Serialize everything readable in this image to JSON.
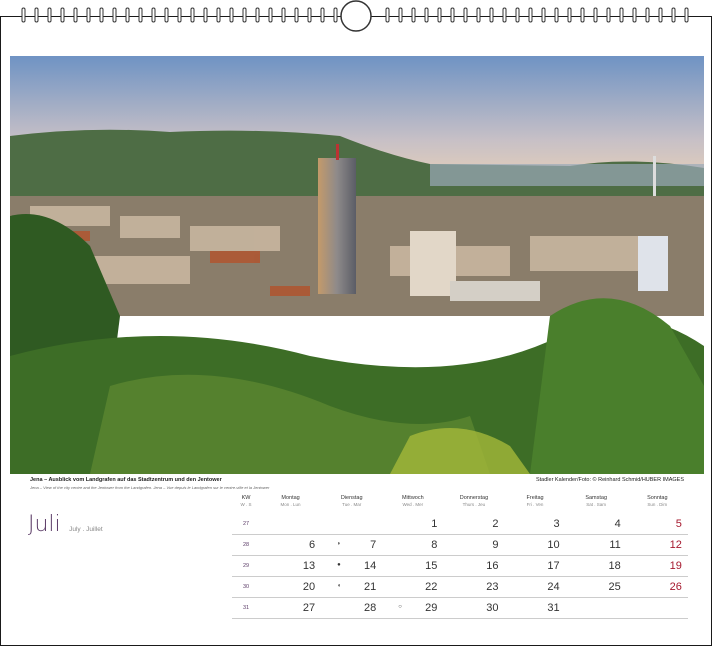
{
  "photo": {
    "caption": "Jena – Ausblick vom Landgrafen auf das Stadtzentrum und den Jentower",
    "caption_en": "Jena – View of the city centre and the Jentower from the Landgrafen. Jena – Vue depuis le Landgrafen sur le centre-ville et la Jentower",
    "credit": "Stadler Kalender/Foto: © Reinhard Schmid/HUBER IMAGES"
  },
  "month": {
    "name": "Juli",
    "sub": "July . Juillet"
  },
  "calendar": {
    "kw_header": {
      "t1": "KW",
      "t2": "W . S"
    },
    "weekdays": [
      {
        "t1": "Montag",
        "t2": "Mon . Lun"
      },
      {
        "t1": "Dienstag",
        "t2": "Tue . Mar"
      },
      {
        "t1": "Mittwoch",
        "t2": "Wed . Mer"
      },
      {
        "t1": "Donnerstag",
        "t2": "Thurs . Jeu"
      },
      {
        "t1": "Freitag",
        "t2": "Fri . Ven"
      },
      {
        "t1": "Samstag",
        "t2": "Sat . Sam"
      },
      {
        "t1": "Sonntag",
        "t2": "Sun . Dim"
      }
    ],
    "weeks": [
      {
        "kw": "27",
        "days": [
          "",
          "",
          "1",
          "2",
          "3",
          "4",
          "5"
        ],
        "moons": [
          "",
          "",
          "",
          "",
          "",
          "",
          ""
        ]
      },
      {
        "kw": "28",
        "days": [
          "6",
          "7",
          "8",
          "9",
          "10",
          "11",
          "12"
        ],
        "moons": [
          "",
          "◗",
          "",
          "",
          "",
          "",
          ""
        ]
      },
      {
        "kw": "29",
        "days": [
          "13",
          "14",
          "15",
          "16",
          "17",
          "18",
          "19"
        ],
        "moons": [
          "",
          "●",
          "",
          "",
          "",
          "",
          ""
        ]
      },
      {
        "kw": "30",
        "days": [
          "20",
          "21",
          "22",
          "23",
          "24",
          "25",
          "26"
        ],
        "moons": [
          "",
          "◖",
          "",
          "",
          "",
          "",
          ""
        ]
      },
      {
        "kw": "31",
        "days": [
          "27",
          "28",
          "29",
          "30",
          "31",
          "",
          ""
        ],
        "moons": [
          "",
          "",
          "○",
          "",
          "",
          "",
          ""
        ]
      }
    ]
  },
  "colors": {
    "accent": "#5a3a66",
    "sunday": "#a6192e"
  }
}
